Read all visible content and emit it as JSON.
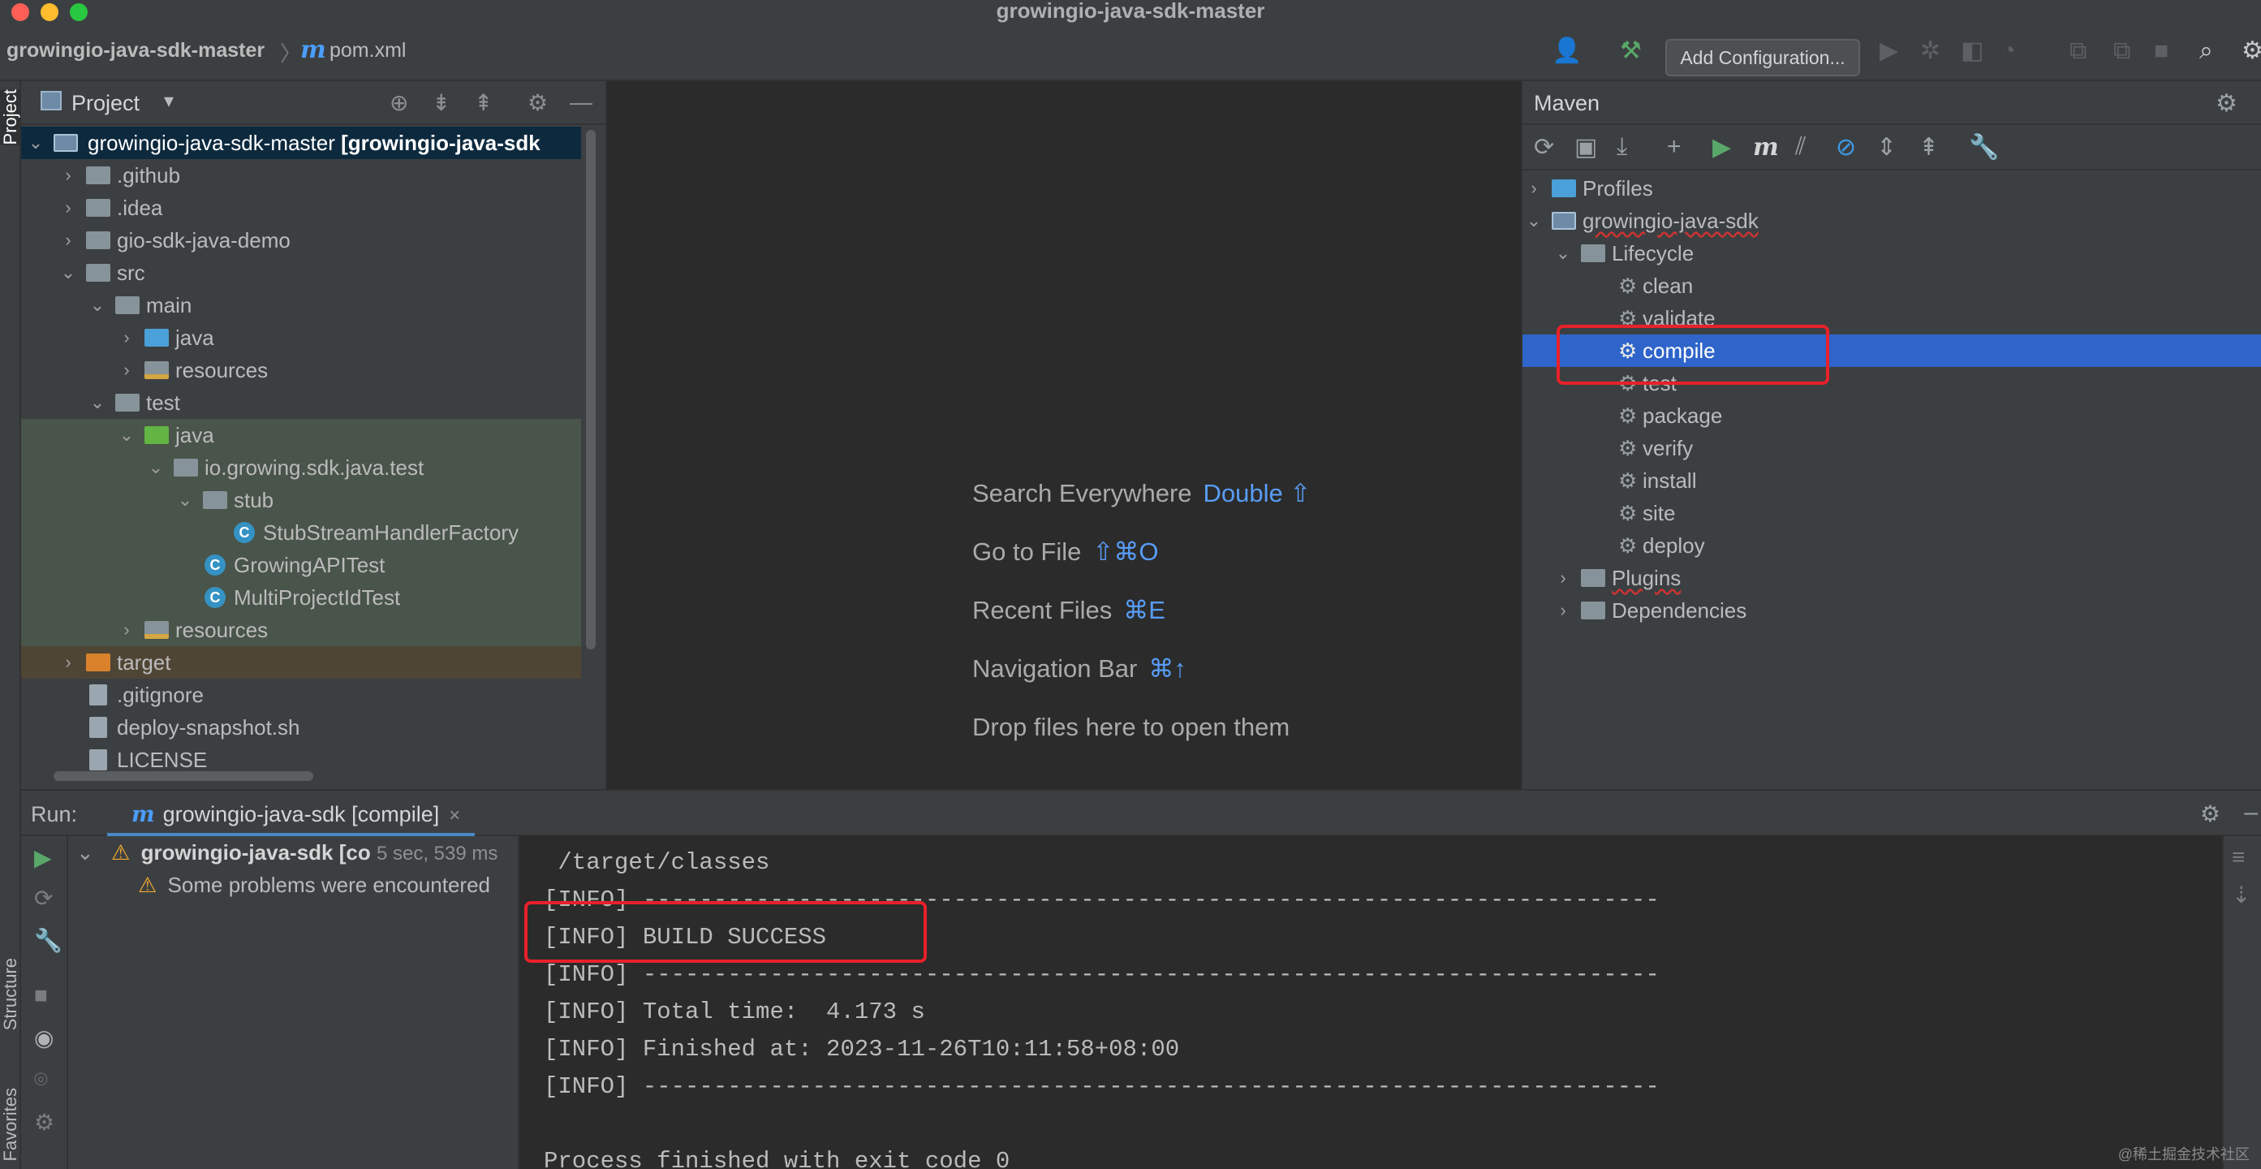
{
  "window": {
    "title": "growingio-java-sdk-master",
    "colors": {
      "close": "#ff5f57",
      "minimize": "#febc2e",
      "zoom": "#28c840"
    }
  },
  "breadcrumb": {
    "project": "growingio-java-sdk-master",
    "separator": "〉",
    "file_icon": "m",
    "file": "pom.xml"
  },
  "toolbar": {
    "add_configuration": "Add Configuration...",
    "icons": [
      "user-icon",
      "build-hammer-icon",
      "run-icon",
      "debug-icon",
      "coverage-icon",
      "profile-icon",
      "attach-icon",
      "stop-icon",
      "search-icon",
      "settings-icon"
    ]
  },
  "side_tabs": {
    "project": "Project",
    "structure": "Structure",
    "favorites": "Favorites"
  },
  "project_panel": {
    "title": "Project",
    "tree": [
      {
        "label": "growingio-java-sdk-master",
        "suffix": " [growingio-java-sdk",
        "icon": "module",
        "expanded": true,
        "selected": true
      },
      {
        "label": ".github",
        "icon": "folder"
      },
      {
        "label": ".idea",
        "icon": "folder"
      },
      {
        "label": "gio-sdk-java-demo",
        "icon": "folder"
      },
      {
        "label": "src",
        "icon": "folder",
        "expanded": true
      },
      {
        "label": "main",
        "icon": "folder",
        "expanded": true
      },
      {
        "label": "java",
        "icon": "folder-blue"
      },
      {
        "label": "resources",
        "icon": "folder-resources"
      },
      {
        "label": "test",
        "icon": "folder",
        "expanded": true
      },
      {
        "label": "java",
        "icon": "folder-green",
        "expanded": true
      },
      {
        "label": "io.growing.sdk.java.test",
        "icon": "package",
        "expanded": true
      },
      {
        "label": "stub",
        "icon": "package",
        "expanded": true
      },
      {
        "label": "StubStreamHandlerFactory",
        "icon": "class"
      },
      {
        "label": "GrowingAPITest",
        "icon": "class"
      },
      {
        "label": "MultiProjectIdTest",
        "icon": "class"
      },
      {
        "label": "resources",
        "icon": "folder-resources"
      },
      {
        "label": "target",
        "icon": "folder-orange"
      },
      {
        "label": ".gitignore",
        "icon": "file"
      },
      {
        "label": "deploy-snapshot.sh",
        "icon": "file"
      },
      {
        "label": "LICENSE",
        "icon": "file"
      }
    ]
  },
  "editor": {
    "hints": [
      {
        "text": "Search Everywhere",
        "key": "Double ⇧"
      },
      {
        "text": "Go to File",
        "key": "⇧⌘O"
      },
      {
        "text": "Recent Files",
        "key": "⌘E"
      },
      {
        "text": "Navigation Bar",
        "key": "⌘↑"
      },
      {
        "text": "Drop files here to open them",
        "key": ""
      }
    ]
  },
  "maven_panel": {
    "title": "Maven",
    "toolbar_glyphs": {
      "run": "▶",
      "m": "m"
    },
    "tree": [
      {
        "label": "Profiles",
        "icon": "profiles"
      },
      {
        "label": "growingio-java-sdk",
        "icon": "maven-module",
        "expanded": true
      },
      {
        "label": "Lifecycle",
        "icon": "lifecycle",
        "expanded": true
      },
      {
        "label": "clean",
        "icon": "gear"
      },
      {
        "label": "validate",
        "icon": "gear"
      },
      {
        "label": "compile",
        "icon": "gear",
        "selected": true
      },
      {
        "label": "test",
        "icon": "gear"
      },
      {
        "label": "package",
        "icon": "gear"
      },
      {
        "label": "verify",
        "icon": "gear"
      },
      {
        "label": "install",
        "icon": "gear"
      },
      {
        "label": "site",
        "icon": "gear"
      },
      {
        "label": "deploy",
        "icon": "gear"
      },
      {
        "label": "Plugins",
        "icon": "plugins"
      },
      {
        "label": "Dependencies",
        "icon": "dependencies"
      }
    ]
  },
  "run_panel": {
    "label": "Run:",
    "tab": {
      "icon": "m",
      "title": "growingio-java-sdk [compile]",
      "close": "×"
    },
    "tree": [
      {
        "label": "growingio-java-sdk [co",
        "time": "5 sec, 539 ms",
        "status": "warning"
      },
      {
        "label": "Some problems were encountered",
        "status": "warning"
      }
    ],
    "console_lines": [
      " /target/classes",
      "[INFO] ------------------------------------------------------------------------",
      "[INFO] BUILD SUCCESS",
      "[INFO] ------------------------------------------------------------------------",
      "[INFO] Total time:  4.173 s",
      "[INFO] Finished at: 2023-11-26T10:11:58+08:00",
      "[INFO] ------------------------------------------------------------------------",
      "",
      "Process finished with exit code 0"
    ]
  },
  "watermark": "@稀土掘金技术社区",
  "colors": {
    "background": "#2b2b2b",
    "panel": "#3c3f41",
    "maven_selection": "#2f65ca",
    "highlight_box": "#e8212b",
    "shortcut_key": "#589df6"
  }
}
